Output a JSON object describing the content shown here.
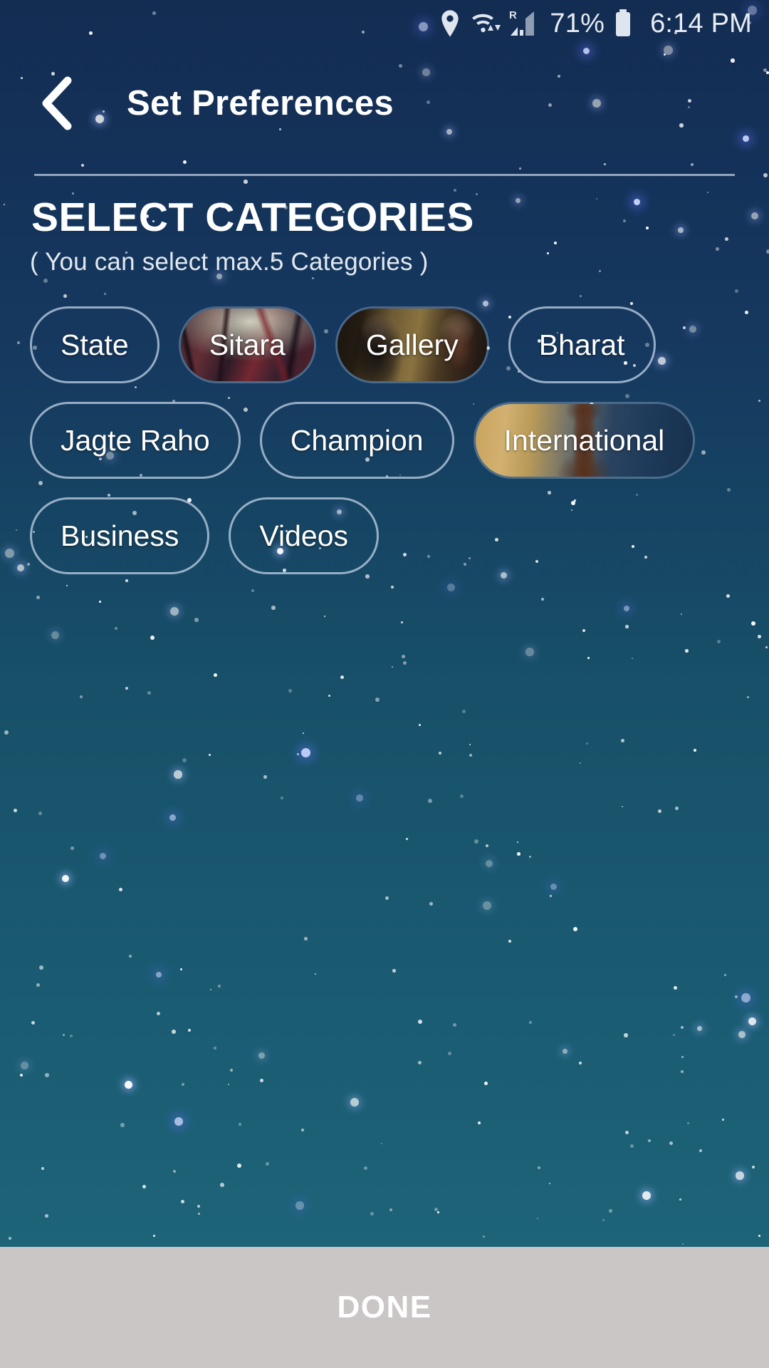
{
  "status_bar": {
    "icons": [
      "location-pin-icon",
      "wifi-icon",
      "roaming-icon",
      "signal-bars-icon",
      "battery-icon"
    ],
    "roaming_label": "R",
    "battery_percent": "71%",
    "time": "6:14 PM"
  },
  "app_bar": {
    "back_icon": "back-chevron-icon",
    "title": "Set Preferences"
  },
  "main": {
    "section_title": "SELECT CATEGORIES",
    "section_hint": "( You can select max.5 Categories )",
    "max_selectable": 5,
    "categories": [
      {
        "label": "State",
        "selected": false,
        "image": ""
      },
      {
        "label": "Sitara",
        "selected": true,
        "image": "img-sitara"
      },
      {
        "label": "Gallery",
        "selected": true,
        "image": "img-gallery"
      },
      {
        "label": "Bharat",
        "selected": false,
        "image": ""
      },
      {
        "label": "Jagte Raho",
        "selected": false,
        "image": ""
      },
      {
        "label": "Champion",
        "selected": false,
        "image": ""
      },
      {
        "label": "International",
        "selected": true,
        "image": "img-international"
      },
      {
        "label": "Business",
        "selected": false,
        "image": ""
      },
      {
        "label": "Videos",
        "selected": false,
        "image": ""
      }
    ]
  },
  "bottom_bar": {
    "done_label": "DONE"
  },
  "colors": {
    "background_top": "#132c52",
    "background_bottom": "#1f6a7e",
    "chip_border": "#c8d8eb",
    "done_bar": "#c9c6c5",
    "text_primary": "#ffffff"
  }
}
